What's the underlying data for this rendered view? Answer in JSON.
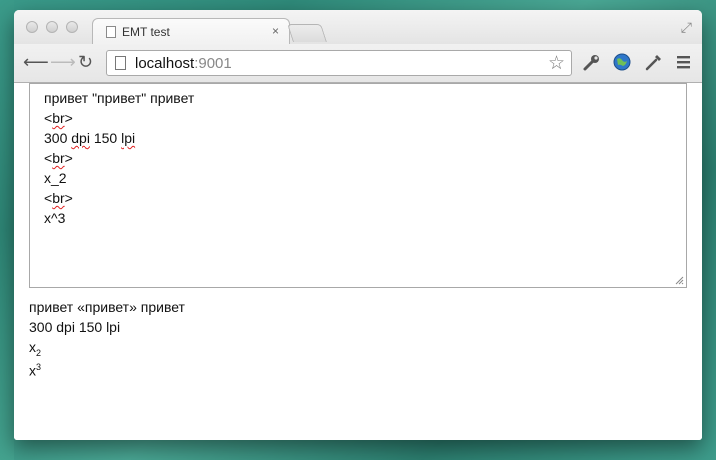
{
  "browser": {
    "tab_title": "EMT test",
    "tab_close": "×",
    "url_host": "localhost",
    "url_port": ":9001"
  },
  "textarea": {
    "lines": [
      {
        "before": "привет \"привет\" привет",
        "mark": "",
        "after": ""
      },
      {
        "before": "<",
        "mark": "br",
        "after": ">"
      },
      {
        "before": "300 ",
        "mark": "dpi",
        "after": " 150 ",
        "mark2": "lpi"
      },
      {
        "before": "<",
        "mark": "br",
        "after": ">"
      },
      {
        "before": "x_2",
        "mark": "",
        "after": ""
      },
      {
        "before": "<",
        "mark": "br",
        "after": ">"
      },
      {
        "before": "x^3",
        "mark": "",
        "after": ""
      }
    ]
  },
  "output": {
    "line1": "привет «привет» привет",
    "line2": "300 dpi 150 lpi",
    "line3_base": "x",
    "line3_sub": "2",
    "line4_base": "x",
    "line4_sup": "3"
  },
  "icons": [
    "back-arrow-icon",
    "forward-arrow-icon",
    "reload-icon",
    "page-icon",
    "star-icon",
    "wrench-icon",
    "globe-icon",
    "dropper-icon",
    "menu-icon"
  ]
}
